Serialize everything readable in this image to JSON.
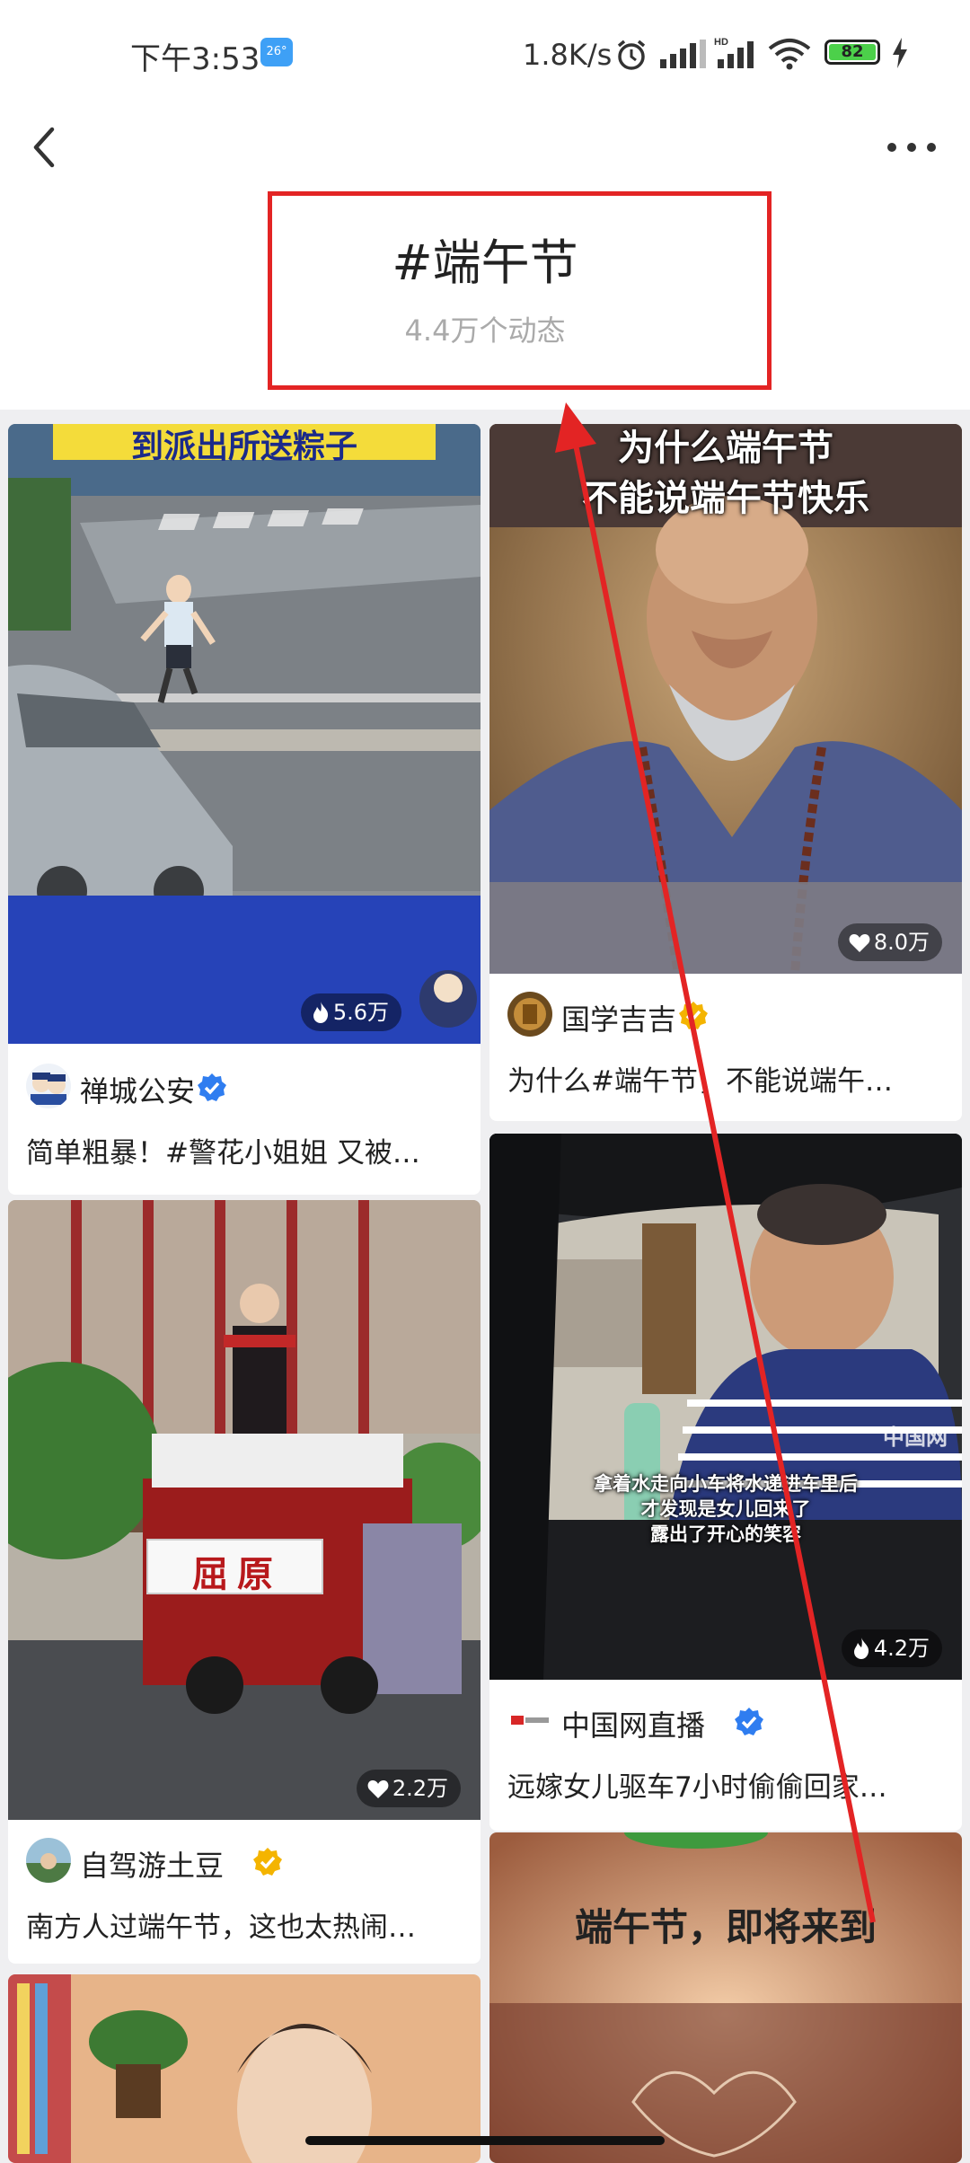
{
  "status": {
    "time": "下午3:53",
    "weather": "26°",
    "network": "1.8K/s",
    "battery": "82"
  },
  "topic": {
    "title": "#端午节",
    "count": "4.4万个动态"
  },
  "cards": [
    {
      "banner": "到派出所送粽子",
      "likes": "5.6万",
      "author": "禅城公安",
      "desc": "简单粗暴！#警花小姐姐 又被…"
    },
    {
      "banner_line1": "为什么端午节",
      "banner_line2": "不能说端午节快乐",
      "likes": "8.0万",
      "author": "国学吉吉",
      "desc": "为什么#端午节，不能说端午…"
    },
    {
      "sign": "屈原",
      "likes": "2.2万",
      "author": "自驾游土豆",
      "desc": "南方人过端午节，这也太热闹…"
    },
    {
      "subtitle_line1": "拿着水走向小车将水递进车里后",
      "subtitle_line2": "才发现是女儿回来了",
      "subtitle_line3": "露出了开心的笑容",
      "watermark": "中国网",
      "likes": "4.2万",
      "author": "中国网直播",
      "desc": "远嫁女儿驱车7小时偷偷回家…"
    },
    {
      "banner": "端午节，即将来到"
    }
  ]
}
